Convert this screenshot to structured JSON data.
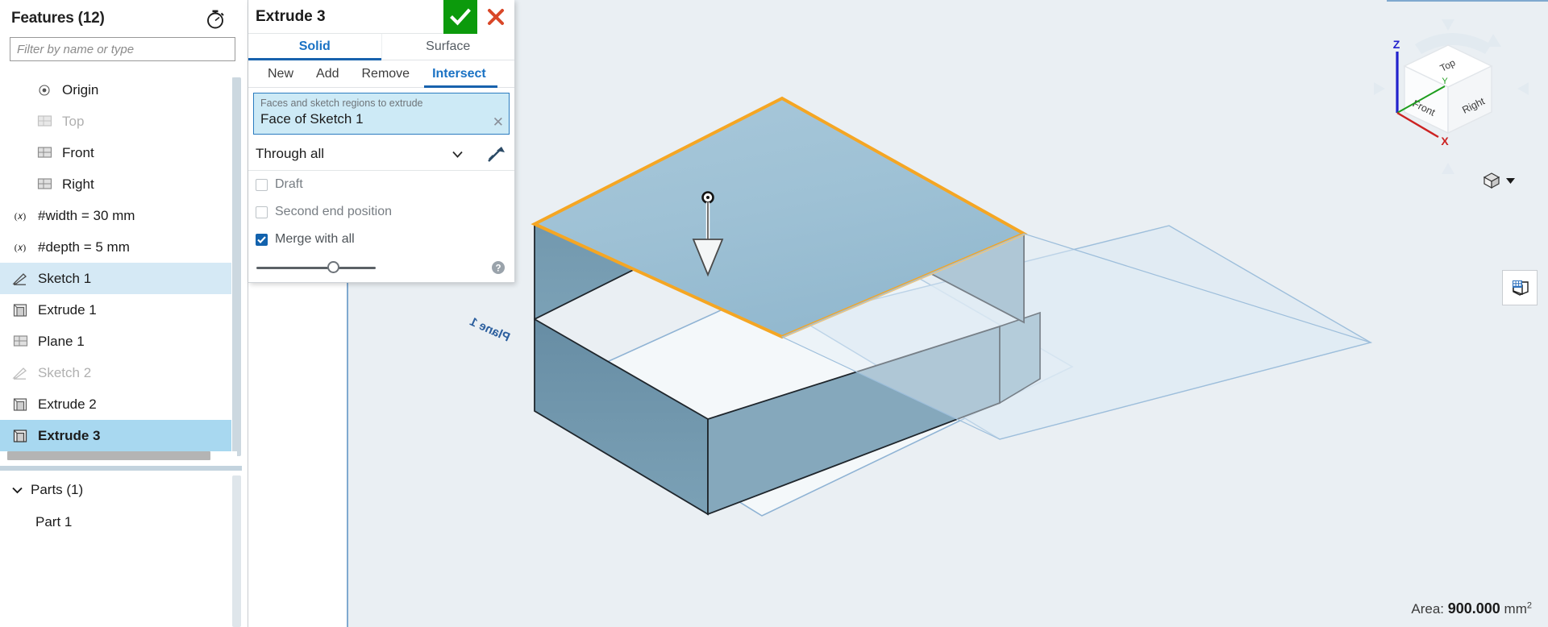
{
  "features_panel": {
    "title": "Features (12)",
    "timer_icon": "stopwatch-icon",
    "filter_placeholder": "Filter by name or type",
    "filter_value": "",
    "items": [
      {
        "label": "Origin",
        "icon": "origin-icon",
        "indent": true,
        "state": "normal"
      },
      {
        "label": "Top",
        "icon": "plane-icon",
        "indent": true,
        "state": "dim"
      },
      {
        "label": "Front",
        "icon": "plane-icon",
        "indent": true,
        "state": "normal"
      },
      {
        "label": "Right",
        "icon": "plane-icon",
        "indent": true,
        "state": "normal"
      },
      {
        "label": "#width = 30 mm",
        "icon": "variable-icon",
        "indent": false,
        "state": "normal"
      },
      {
        "label": "#depth = 5 mm",
        "icon": "variable-icon",
        "indent": false,
        "state": "normal"
      },
      {
        "label": "Sketch 1",
        "icon": "sketch-icon",
        "indent": false,
        "state": "light-selected"
      },
      {
        "label": "Extrude 1",
        "icon": "extrude-icon",
        "indent": false,
        "state": "normal"
      },
      {
        "label": "Plane 1",
        "icon": "plane-icon",
        "indent": false,
        "state": "normal"
      },
      {
        "label": "Sketch 2",
        "icon": "sketch-icon",
        "indent": false,
        "state": "dim"
      },
      {
        "label": "Extrude 2",
        "icon": "extrude-icon",
        "indent": false,
        "state": "normal"
      },
      {
        "label": "Extrude 3",
        "icon": "extrude-icon",
        "indent": false,
        "state": "selected"
      }
    ],
    "parts": {
      "header": "Parts (1)",
      "caret_icon": "chevron-down-icon",
      "items": [
        "Part 1"
      ]
    }
  },
  "extrude_dialog": {
    "title": "Extrude 3",
    "ok_icon": "check-icon",
    "cancel_icon": "close-icon",
    "tabs": [
      {
        "label": "Solid",
        "active": true
      },
      {
        "label": "Surface",
        "active": false
      }
    ],
    "operations": [
      {
        "label": "New",
        "active": false
      },
      {
        "label": "Add",
        "active": false
      },
      {
        "label": "Remove",
        "active": false
      },
      {
        "label": "Intersect",
        "active": true
      }
    ],
    "selection": {
      "hint": "Faces and sketch regions to extrude",
      "value": "Face of Sketch 1",
      "clear_icon": "close-small-icon"
    },
    "end_condition": {
      "value": "Through all",
      "caret_icon": "chevron-down-icon",
      "flip_icon": "flip-direction-icon"
    },
    "checkboxes": [
      {
        "label": "Draft",
        "checked": false
      },
      {
        "label": "Second end position",
        "checked": false
      },
      {
        "label": "Merge with all",
        "checked": true
      }
    ],
    "slider": {
      "value": 60
    },
    "help_icon": "help-icon"
  },
  "viewport": {
    "plane_label": "Plane 1",
    "direction_arrow_icon": "extrude-direction-arrow-icon",
    "view_cube": {
      "faces": [
        "Top",
        "Front",
        "Right"
      ],
      "axes": [
        {
          "label": "Z",
          "color": "#2222cc"
        },
        {
          "label": "Y",
          "color": "#1e9e1e"
        },
        {
          "label": "X",
          "color": "#cc2222"
        }
      ]
    },
    "display_mode": {
      "icon": "shaded-cube-icon",
      "caret_icon": "chevron-down-icon"
    },
    "right_tool": {
      "icon": "appearance-cube-icon"
    }
  },
  "status": {
    "label": "Area:",
    "value": "900.000",
    "unit": "mm",
    "exponent": "2"
  },
  "colors": {
    "accent_blue": "#1a72c4",
    "tab_underline": "#1862ad",
    "selection_row": "#a8d8f0",
    "selection_box_bg": "#cdeaf6",
    "ok_green": "#0c9a0c",
    "cancel_red": "#d94728",
    "highlight_orange": "#f5a623",
    "solid_face": "#9dc0d4",
    "solid_side_dark": "#6e8fa4",
    "viewport_bg": "#eaeff3",
    "plane_stroke": "#7fa9cf"
  }
}
